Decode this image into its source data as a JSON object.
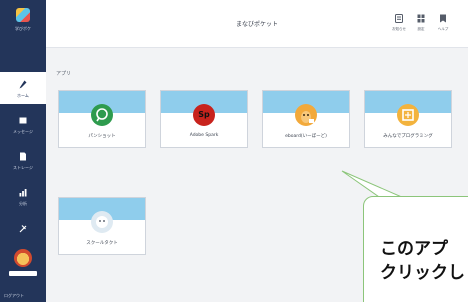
{
  "sidebar": {
    "logo_text": "学びポケ",
    "items": [
      {
        "label": "ホーム",
        "icon": "pencil-icon"
      },
      {
        "label": "メッセージ",
        "icon": "message-icon"
      },
      {
        "label": "ストレージ",
        "icon": "document-icon"
      },
      {
        "label": "分析",
        "icon": "chart-icon"
      },
      {
        "label": "",
        "icon": "tools-icon"
      }
    ],
    "logout_label": "ログアウト"
  },
  "header": {
    "title": "まなびポケット",
    "buttons": [
      {
        "label": "お知らせ",
        "icon": "notice-icon"
      },
      {
        "label": "設定",
        "icon": "grid-icon"
      },
      {
        "label": "ヘルプ",
        "icon": "help-icon"
      }
    ]
  },
  "main": {
    "section_label": "アプリ",
    "apps": [
      {
        "name": "パンショット",
        "icon": "panshot-icon",
        "icon_color": "#2e9b4e",
        "glyph": ""
      },
      {
        "name": "Adobe Spark",
        "icon": "adobe-spark-icon",
        "icon_color": "#c8231d",
        "glyph": "Sp"
      },
      {
        "name": "eboard(いーぼーど)",
        "icon": "eboard-icon",
        "icon_color": "#f2a93b",
        "glyph": ""
      },
      {
        "name": "みんなでプログラミング",
        "icon": "programming-icon",
        "icon_color": "#f3b33d",
        "glyph": ""
      },
      {
        "name": "スクールタクト",
        "icon": "schooltakt-icon",
        "icon_color": "#dfeaf2",
        "glyph": ""
      }
    ]
  },
  "callout": {
    "line1": "このアプ",
    "line2": "クリックし"
  },
  "colors": {
    "sidebar": "#23355a",
    "card_band": "#8fcdec",
    "callout_border": "#8cc57a"
  }
}
